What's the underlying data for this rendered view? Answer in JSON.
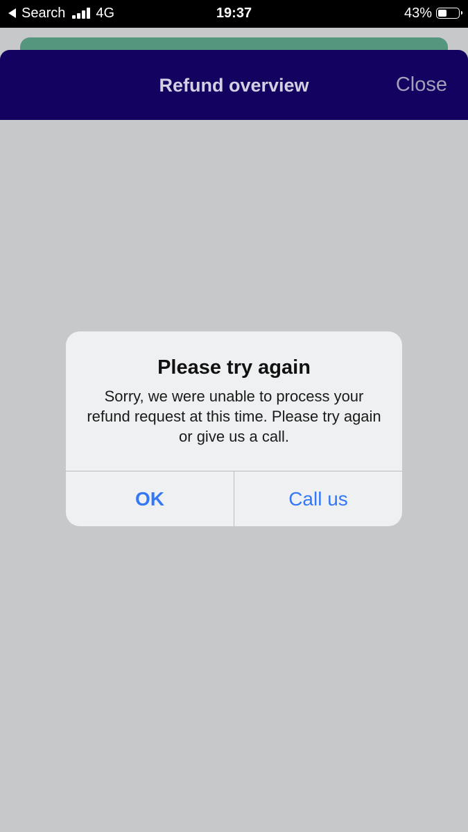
{
  "status_bar": {
    "back_label": "Search",
    "network": "4G",
    "time": "19:37",
    "battery_percent_label": "43%",
    "battery_level": 0.43,
    "icons": [
      "back-arrow-icon",
      "signal-icon",
      "battery-icon"
    ]
  },
  "header": {
    "title": "Refund overview",
    "close_label": "Close"
  },
  "alert": {
    "title": "Please try again",
    "message": "Sorry, we were unable to process your refund request at this time. Please try again or give us a call.",
    "ok_label": "OK",
    "call_label": "Call us"
  },
  "colors": {
    "nav_background": "#130260",
    "sheet_behind": "#55967f",
    "content_background": "#c7c8ca",
    "alert_background": "#eff0f1",
    "button_blue": "#3478f6"
  }
}
